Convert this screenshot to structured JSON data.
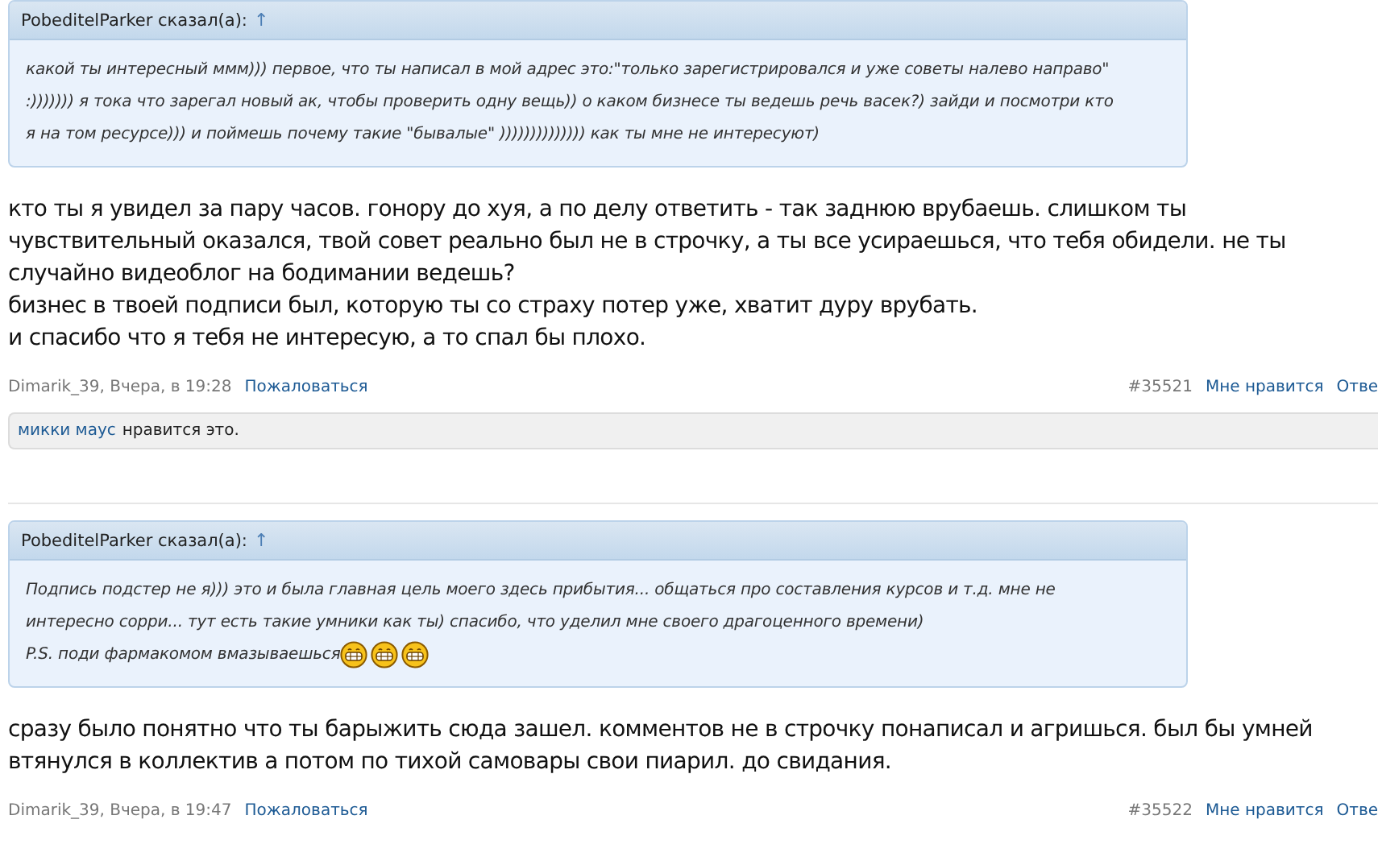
{
  "posts": [
    {
      "quote": {
        "author": "PobeditelParker сказал(а):",
        "jump": "↑",
        "text": "какой ты интересный ммм))) первое, что ты написал в мой адрес это:\"только зарегистрировался и уже советы налево направо\"\n:))))))) я тока что зарегал новый ак, чтобы проверить одну вещь)) о каком бизнесе ты ведешь речь васек?) зайди и посмотри кто\nя на том ресурсе))) и поймешь почему такие \"бывалые\" )))))))))))))) как ты мне не интересуют)"
      },
      "text": "кто ты я увидел за пару часов. гонору до хуя, а по делу ответить - так заднюю врубаешь. слишком ты\nчувствительный оказался, твой совет реально был не в строчку, а ты все усираешься, что тебя обидели. не ты\nслучайно видеоблог на бодимании ведешь?\nбизнес в твоей подписи был, которую ты со страху потер уже, хватит дуру врубать.\nи спасибо что я тебя не интересую, а то спал бы плохо.",
      "meta": "Dimarik_39, Вчера, в 19:28",
      "report": "Пожаловаться",
      "number": "#35521",
      "like": "Мне нравится",
      "reply": "Отве",
      "likes": {
        "who": "микки маус",
        "rest": "нравится это."
      }
    },
    {
      "quote": {
        "author": "PobeditelParker сказал(а):",
        "jump": "↑",
        "text": "Подпись подстер не я))) это и была главная цель моего здесь прибытия... общаться про составления курсов и т.д. мне не\nинтересно сорри... тут есть такие умники как ты) спасибо, что уделил мне своего драгоценного времени)\nP.S. поди фармакомом вмазываешься",
        "emoticons": [
          {
            "kind": "grin"
          },
          {
            "kind": "grin"
          },
          {
            "kind": "grin"
          }
        ]
      },
      "text": "сразу было понятно что ты барыжить сюда зашел. комментов не в строчку понаписал и агришься. был бы умней\nвтянулся в коллектив а потом по тихой самовары свои пиарил. до свидания.",
      "meta": "Dimarik_39, Вчера, в 19:47",
      "report": "Пожаловаться",
      "number": "#35522",
      "like": "Мне нравится",
      "reply": "Отве"
    }
  ]
}
